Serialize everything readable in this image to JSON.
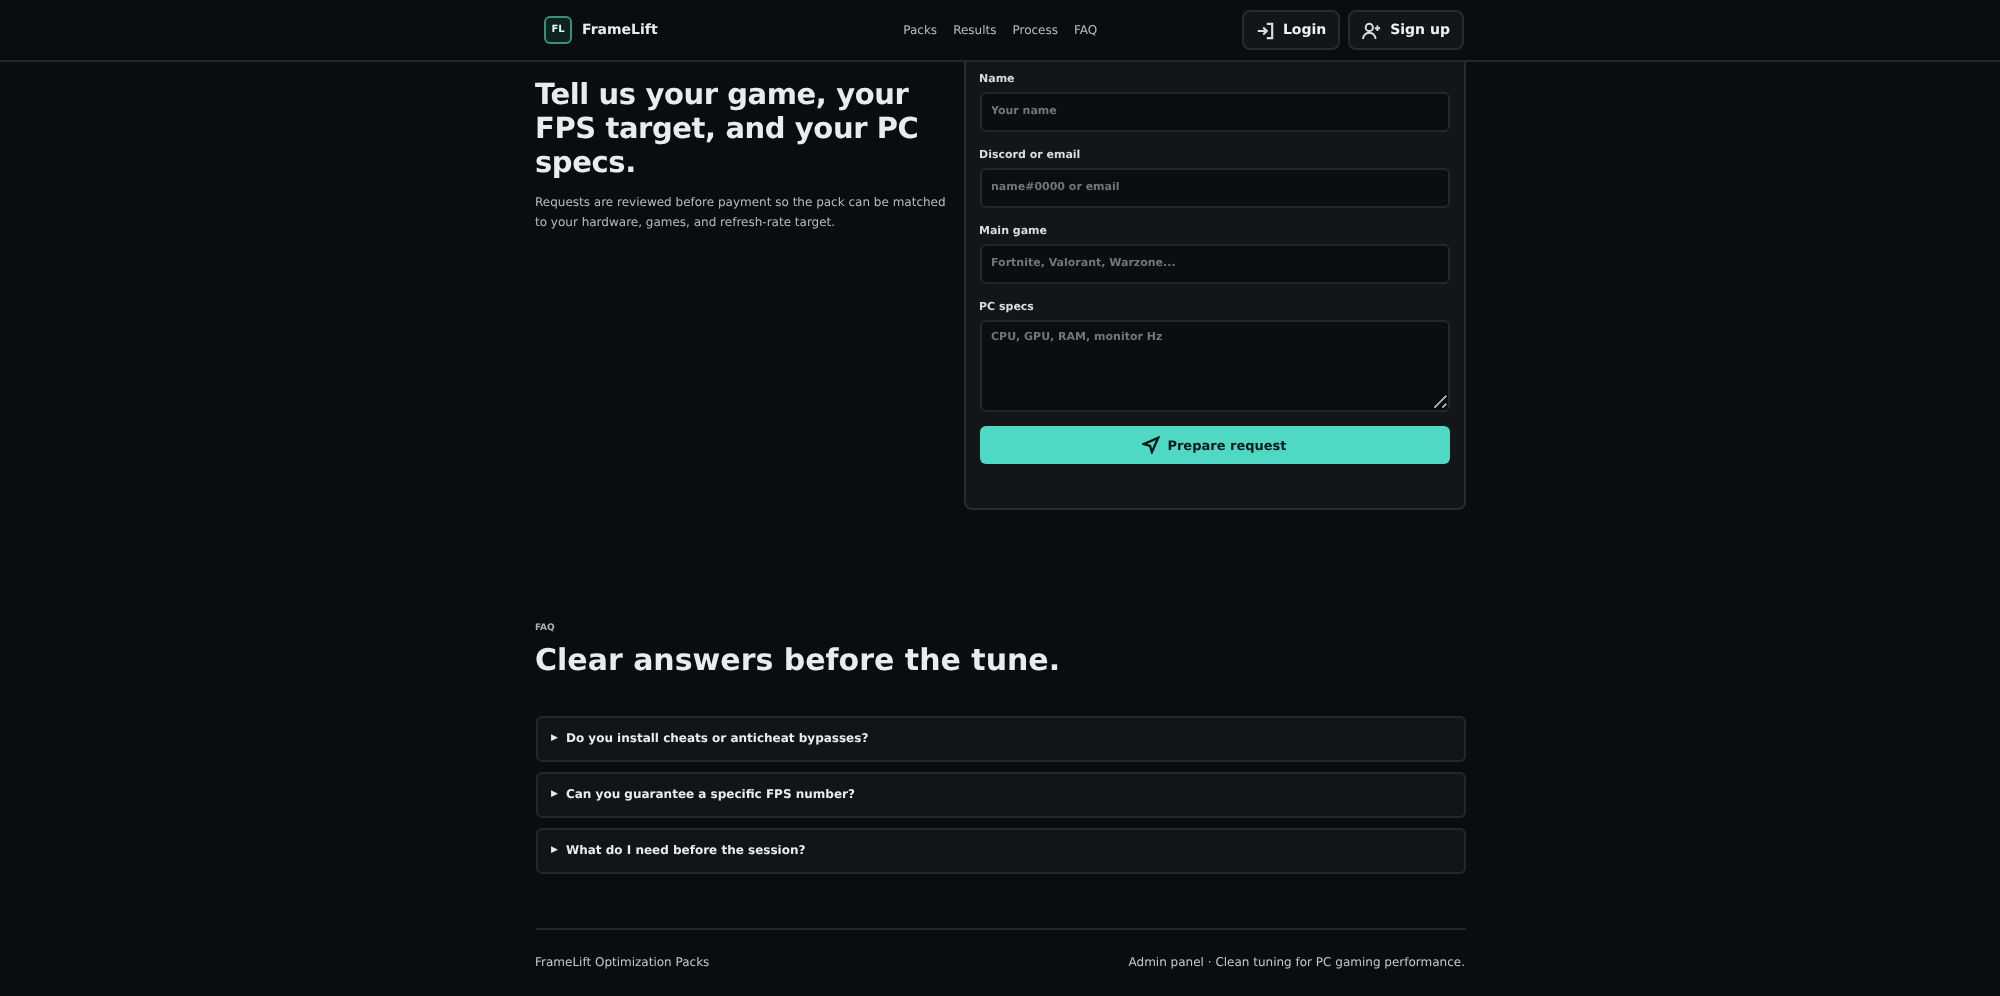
{
  "header": {
    "logo_mark": "FL",
    "brand": "FrameLift",
    "nav": [
      "Packs",
      "Results",
      "Process",
      "FAQ"
    ],
    "login": "Login",
    "signup": "Sign up"
  },
  "request": {
    "title": "Tell us your game, your FPS target, and your PC specs.",
    "intro": "Requests are reviewed before payment so the pack can be matched to your hardware, games, and refresh-rate target.",
    "fields": [
      {
        "label": "Name",
        "placeholder": "Your name",
        "kind": "input"
      },
      {
        "label": "Discord or email",
        "placeholder": "name#0000 or email",
        "kind": "input"
      },
      {
        "label": "Main game",
        "placeholder": "Fortnite, Valorant, Warzone...",
        "kind": "input"
      },
      {
        "label": "PC specs",
        "placeholder": "CPU, GPU, RAM, monitor Hz",
        "kind": "textarea"
      }
    ],
    "submit": "Prepare request"
  },
  "faq": {
    "eyebrow": "FAQ",
    "title": "Clear answers before the tune.",
    "items": [
      {
        "marker": "▶",
        "question": "Do you install cheats or anticheat bypasses?",
        "expanded": false
      },
      {
        "marker": "▶",
        "question": "Can you guarantee a specific FPS number?",
        "expanded": false
      },
      {
        "marker": "▶",
        "question": "What do I need before the session?",
        "expanded": false
      }
    ]
  },
  "footer": {
    "left": "FrameLift Optimization Packs",
    "link": "Admin panel",
    "tagline": "· Clean tuning for PC gaming performance."
  }
}
